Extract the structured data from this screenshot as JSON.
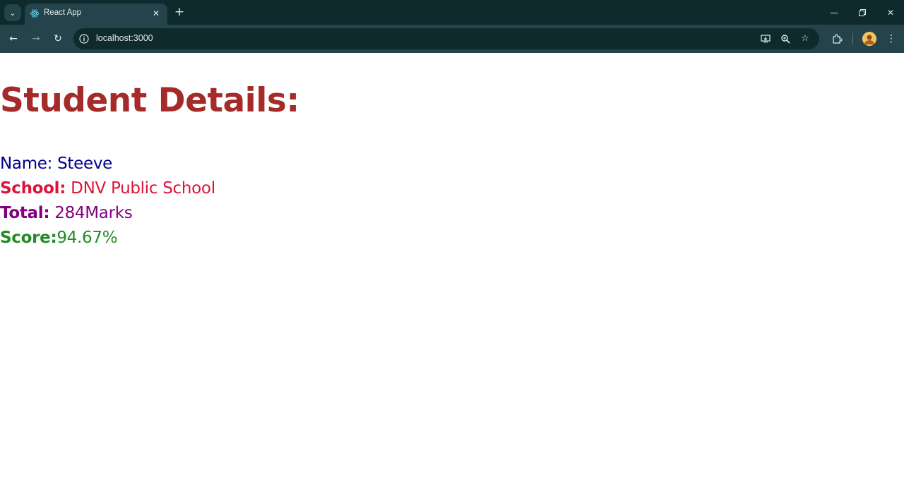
{
  "browser": {
    "tab_title": "React App",
    "url": "localhost:3000",
    "icons": {
      "tab_search": "chevron-down-icon",
      "favicon": "react-icon",
      "tab_close": "close-icon",
      "new_tab": "plus-icon",
      "minimize": "minimize-icon",
      "restore": "restore-icon",
      "close_window": "close-icon",
      "back": "back-arrow-icon",
      "forward": "forward-arrow-icon",
      "reload": "reload-icon",
      "site_info": "info-icon",
      "install": "install-app-icon",
      "zoom": "zoom-icon",
      "bookmark": "star-icon",
      "extensions": "puzzle-icon",
      "menu": "kebab-menu-icon"
    },
    "colors": {
      "tabbar_bg": "#0f2a2d",
      "toolbar_bg": "#24434a"
    }
  },
  "page": {
    "heading": "Student Details:",
    "name_label": "Name:",
    "name_value": " Steeve",
    "school_label": "School:",
    "school_value": " DNV Public School",
    "total_label": "Total:",
    "total_value": " 284Marks",
    "score_label": "Score:",
    "score_value": "94.67%",
    "colors": {
      "heading": "#a52a2a",
      "name": "#00008b",
      "school": "#dc143c",
      "total": "#800080",
      "score": "#228b22"
    }
  }
}
